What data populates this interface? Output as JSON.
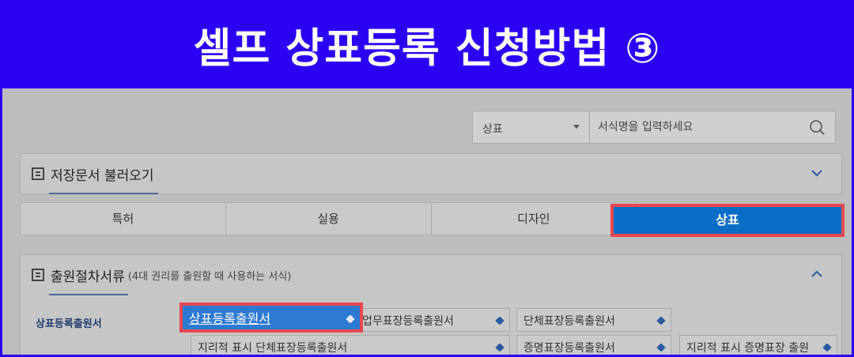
{
  "banner": {
    "title": "셀프 상표등록 신청방법 ③"
  },
  "search": {
    "category": "상표",
    "placeholder": "서식명을 입력하세요"
  },
  "load_panel": {
    "title": "저장문서 불러오기"
  },
  "tabs": [
    "특허",
    "실용",
    "디자인",
    "상표"
  ],
  "active_tab": "상표",
  "forms_panel": {
    "title": "출원절차서류",
    "note": "(4대 권리를 출원할 때 사용하는 서식)",
    "row_label": "상표등록출원서",
    "items": [
      "상표등록출원서",
      "업무표장등록출원서",
      "단체표장등록출원서",
      "지리적 표시 단체표장등록출원서",
      "증명표장등록출원서",
      "지리적 표시 증명표장 출원"
    ]
  },
  "colors": {
    "banner": "#2c00f2",
    "active_tab": "#0a6ec7",
    "highlight_border": "#e8484f"
  }
}
